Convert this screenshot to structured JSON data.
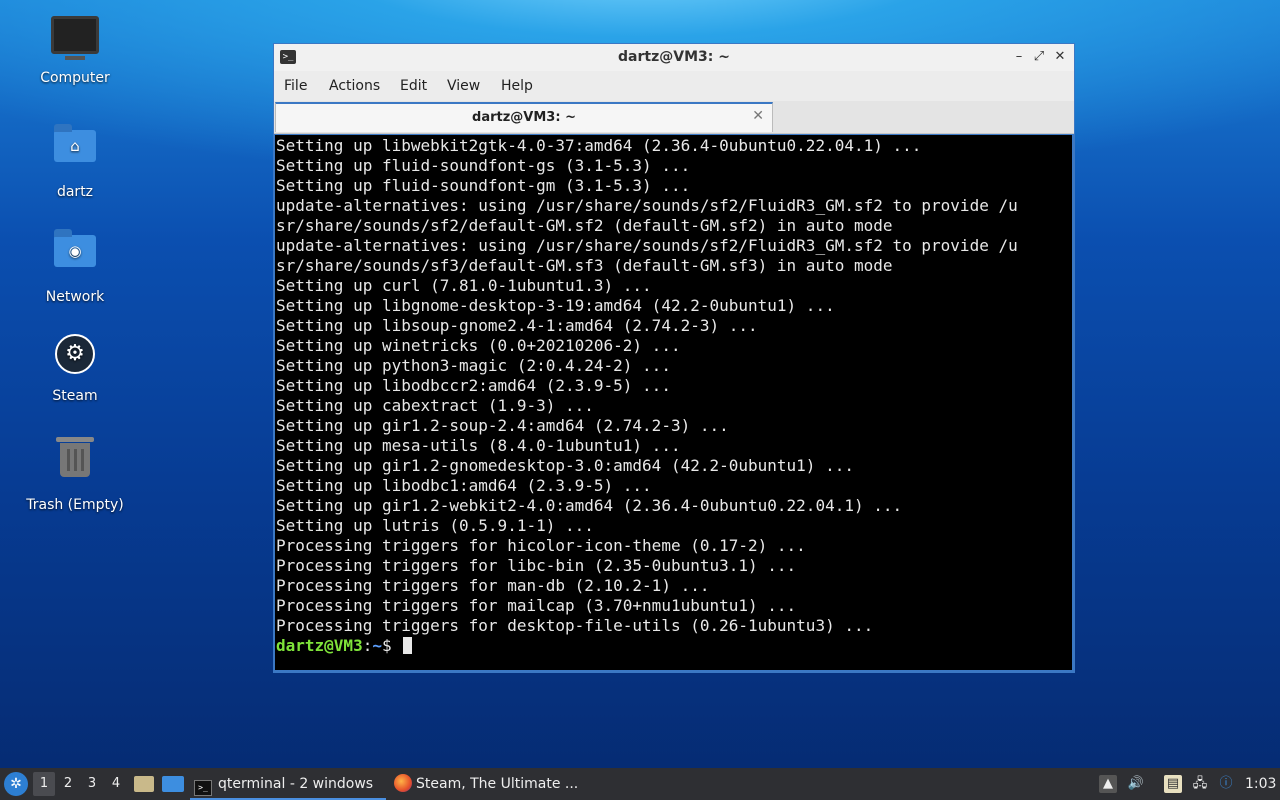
{
  "desktop": {
    "icons": [
      {
        "label": "Computer"
      },
      {
        "label": "dartz"
      },
      {
        "label": "Network"
      },
      {
        "label": "Steam"
      },
      {
        "label": "Trash (Empty)"
      }
    ]
  },
  "window": {
    "title": "dartz@VM3: ~",
    "menu": [
      "File",
      "Actions",
      "Edit",
      "View",
      "Help"
    ],
    "tab_label": "dartz@VM3: ~",
    "terminal_lines": [
      "Setting up libwebkit2gtk-4.0-37:amd64 (2.36.4-0ubuntu0.22.04.1) ...",
      "Setting up fluid-soundfont-gs (3.1-5.3) ...",
      "Setting up fluid-soundfont-gm (3.1-5.3) ...",
      "update-alternatives: using /usr/share/sounds/sf2/FluidR3_GM.sf2 to provide /u",
      "sr/share/sounds/sf2/default-GM.sf2 (default-GM.sf2) in auto mode",
      "update-alternatives: using /usr/share/sounds/sf2/FluidR3_GM.sf2 to provide /u",
      "sr/share/sounds/sf3/default-GM.sf3 (default-GM.sf3) in auto mode",
      "Setting up curl (7.81.0-1ubuntu1.3) ...",
      "Setting up libgnome-desktop-3-19:amd64 (42.2-0ubuntu1) ...",
      "Setting up libsoup-gnome2.4-1:amd64 (2.74.2-3) ...",
      "Setting up winetricks (0.0+20210206-2) ...",
      "Setting up python3-magic (2:0.4.24-2) ...",
      "Setting up libodbccr2:amd64 (2.3.9-5) ...",
      "Setting up cabextract (1.9-3) ...",
      "Setting up gir1.2-soup-2.4:amd64 (2.74.2-3) ...",
      "Setting up mesa-utils (8.4.0-1ubuntu1) ...",
      "Setting up gir1.2-gnomedesktop-3.0:amd64 (42.2-0ubuntu1) ...",
      "Setting up libodbc1:amd64 (2.3.9-5) ...",
      "Setting up gir1.2-webkit2-4.0:amd64 (2.36.4-0ubuntu0.22.04.1) ...",
      "Setting up lutris (0.5.9.1-1) ...",
      "Processing triggers for hicolor-icon-theme (0.17-2) ...",
      "Processing triggers for libc-bin (2.35-0ubuntu3.1) ...",
      "Processing triggers for man-db (2.10.2-1) ...",
      "Processing triggers for mailcap (3.70+nmu1ubuntu1) ...",
      "Processing triggers for desktop-file-utils (0.26-1ubuntu3) ..."
    ],
    "prompt": {
      "user_host": "dartz@VM3",
      "sep": ":",
      "path": "~",
      "symbol": "$ "
    }
  },
  "taskbar": {
    "workspaces": [
      "1",
      "2",
      "3",
      "4"
    ],
    "tasks": [
      {
        "label": "qterminal - 2 windows"
      },
      {
        "label": "Steam, The Ultimate ..."
      }
    ],
    "clock": "1:03"
  },
  "colors": {
    "accent": "#3b78c4",
    "prompt_user": "#7fe33a",
    "prompt_path": "#5da0ff"
  }
}
